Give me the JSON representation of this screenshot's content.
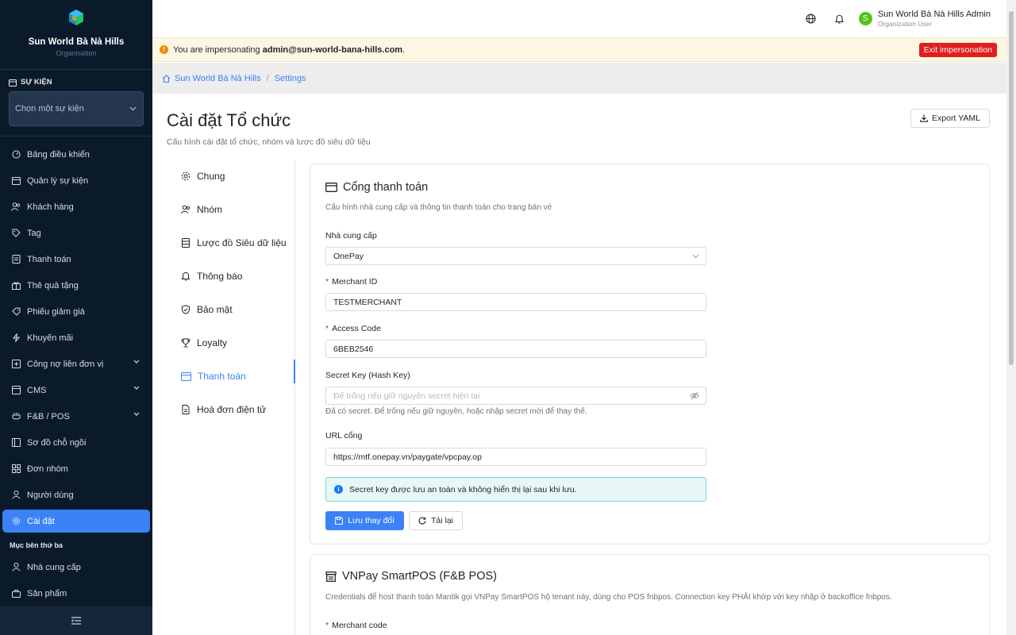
{
  "sidebar": {
    "brand": {
      "name": "Sun World Bà Nà Hills",
      "subtitle": "Organisation"
    },
    "event_section_label": "SỰ KIỆN",
    "event_select_placeholder": "Chọn một sự kiện",
    "items": [
      {
        "label": "Bảng điều khiển",
        "icon": "dashboard-icon"
      },
      {
        "label": "Quản lý sự kiện",
        "icon": "calendar-icon"
      },
      {
        "label": "Khách hàng",
        "icon": "users-icon"
      },
      {
        "label": "Tag",
        "icon": "tag-icon"
      },
      {
        "label": "Thanh toán",
        "icon": "payment-icon"
      },
      {
        "label": "Thẻ quà tặng",
        "icon": "gift-icon"
      },
      {
        "label": "Phiếu giảm giá",
        "icon": "coupon-icon"
      },
      {
        "label": "Khuyến mãi",
        "icon": "promo-icon"
      },
      {
        "label": "Công nợ liên đơn vị",
        "icon": "debt-icon"
      },
      {
        "label": "CMS",
        "icon": "cms-icon"
      },
      {
        "label": "F&B / POS",
        "icon": "fnb-icon"
      },
      {
        "label": "Sơ đồ chỗ ngồi",
        "icon": "seatmap-icon"
      },
      {
        "label": "Đơn nhóm",
        "icon": "group-order-icon"
      },
      {
        "label": "Người dùng",
        "icon": "user-icon"
      },
      {
        "label": "Cài đặt",
        "icon": "settings-icon"
      }
    ],
    "third_party_title": "Mục bên thứ ba",
    "third_party_items": [
      {
        "label": "Nhà cung cấp",
        "icon": "supplier-icon"
      },
      {
        "label": "Sản phẩm",
        "icon": "product-icon"
      }
    ]
  },
  "topbar": {
    "user_initial": "S",
    "user_name": "Sun World Bà Nà Hills Admin",
    "user_role": "Organization User"
  },
  "impersonation": {
    "prefix": "You are impersonating",
    "email": "admin@sun-world-bana-hills.com",
    "suffix": ".",
    "exit_label": "Exit impersonation"
  },
  "breadcrumb": {
    "home": "Sun World Bà Nà Hills",
    "separator": "/",
    "current": "Settings"
  },
  "page": {
    "title": "Cài đặt Tổ chức",
    "subtitle": "Cấu hình cài đặt tổ chức, nhóm và lược đồ siêu dữ liệu",
    "export_label": "Export YAML"
  },
  "tabs": [
    {
      "label": "Chung"
    },
    {
      "label": "Nhóm"
    },
    {
      "label": "Lược đồ Siêu dữ liệu"
    },
    {
      "label": "Thông báo"
    },
    {
      "label": "Bảo mật"
    },
    {
      "label": "Loyalty"
    },
    {
      "label": "Thanh toán"
    },
    {
      "label": "Hoá đơn điện tử"
    }
  ],
  "payment_card": {
    "title": "Cổng thanh toán",
    "description": "Cấu hình nhà cung cấp và thông tin thanh toán cho trang bán vé",
    "provider_label": "Nhà cung cấp",
    "provider_value": "OnePay",
    "merchant_id_label": "Merchant ID",
    "merchant_id_value": "TESTMERCHANT",
    "access_code_label": "Access Code",
    "access_code_value": "6BEB2546",
    "secret_key_label": "Secret Key (Hash Key)",
    "secret_key_placeholder": "Để trống nếu giữ nguyên secret hiện tại",
    "secret_key_helper": "Đã có secret. Để trống nếu giữ nguyên, hoặc nhập secret mới để thay thế.",
    "url_label": "URL cổng",
    "url_value": "https://mtf.onepay.vn/paygate/vpcpay.op",
    "info_text": "Secret key được lưu an toàn và không hiển thị lại sau khi lưu.",
    "save_label": "Lưu thay đổi",
    "reload_label": "Tải lại"
  },
  "vnpay_card": {
    "title": "VNPay SmartPOS (F&B POS)",
    "description": "Credentials để host thanh toán Mantik gọi VNPay SmartPOS hộ tenant này, dùng cho POS fnbpos. Connection key PHẢI khớp với key nhập ở backoffice fnbpos.",
    "merchant_code_label": "Merchant code"
  }
}
